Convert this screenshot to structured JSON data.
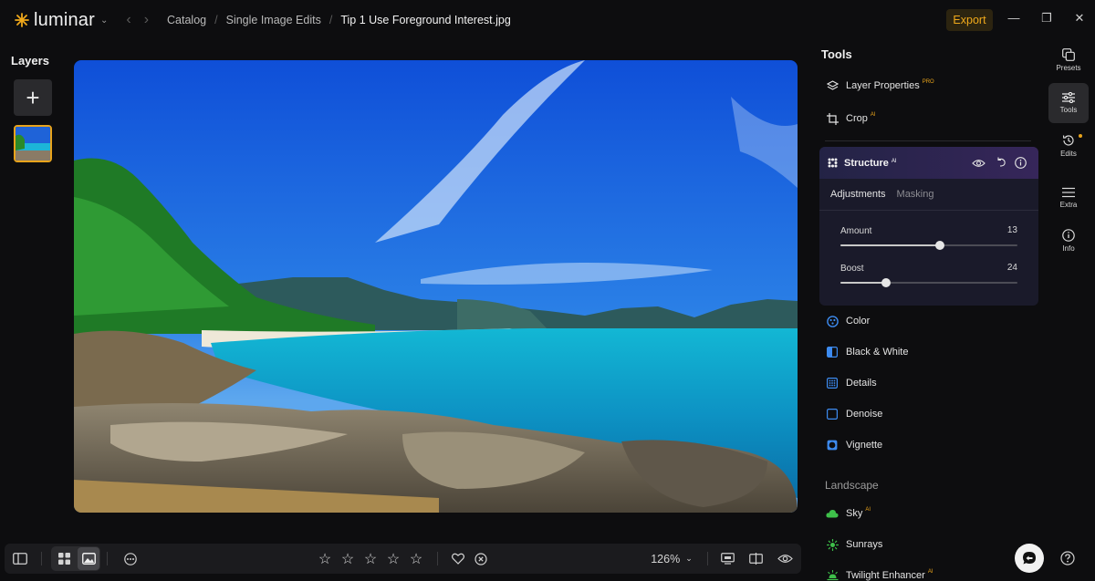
{
  "app": {
    "name": "luminar"
  },
  "breadcrumb": [
    "Catalog",
    "Single Image Edits",
    "Tip 1 Use Foreground Interest.jpg"
  ],
  "header": {
    "export_label": "Export"
  },
  "layers": {
    "title": "Layers"
  },
  "bottombar": {
    "zoom": "126%",
    "rating_stars": 5
  },
  "tools": {
    "title": "Tools",
    "layer_properties": {
      "label": "Layer Properties",
      "badge": "PRO"
    },
    "crop": {
      "label": "Crop",
      "badge": "AI"
    },
    "structure": {
      "label": "Structure",
      "badge": "AI",
      "tabs": [
        "Adjustments",
        "Masking"
      ],
      "sliders": [
        {
          "label": "Amount",
          "value": 13,
          "fraction": 0.56
        },
        {
          "label": "Boost",
          "value": 24,
          "fraction": 0.26
        }
      ]
    },
    "items": [
      {
        "label": "Color",
        "badge": ""
      },
      {
        "label": "Black & White",
        "badge": ""
      },
      {
        "label": "Details",
        "badge": ""
      },
      {
        "label": "Denoise",
        "badge": ""
      },
      {
        "label": "Vignette",
        "badge": ""
      }
    ],
    "landscape": {
      "title": "Landscape",
      "items": [
        {
          "label": "Sky",
          "badge": "AI"
        },
        {
          "label": "Sunrays",
          "badge": ""
        },
        {
          "label": "Twilight Enhancer",
          "badge": "AI"
        }
      ]
    }
  },
  "rail": [
    {
      "label": "Presets",
      "icon": "presets-icon"
    },
    {
      "label": "Tools",
      "icon": "tools-icon"
    },
    {
      "label": "Edits",
      "icon": "history-icon"
    },
    {
      "label": "Extra",
      "icon": "list-icon"
    },
    {
      "label": "Info",
      "icon": "info-icon"
    }
  ],
  "colors": {
    "accent": "#e8a31b",
    "panel": "#1a1a2a"
  }
}
